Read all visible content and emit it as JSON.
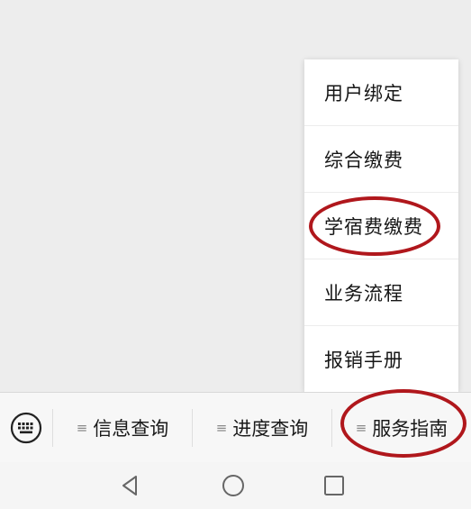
{
  "popup_menu": {
    "items": [
      {
        "label": "用户绑定"
      },
      {
        "label": "综合缴费"
      },
      {
        "label": "学宿费缴费"
      },
      {
        "label": "业务流程"
      },
      {
        "label": "报销手册"
      }
    ]
  },
  "menu_bar": {
    "keyboard_icon": "keyboard-icon",
    "menu_mark": "≡",
    "tabs": [
      {
        "label": "信息查询"
      },
      {
        "label": "进度查询"
      },
      {
        "label": "服务指南"
      }
    ]
  },
  "nav_bar": {
    "icons": [
      "back-triangle-icon",
      "home-circle-icon",
      "recents-square-icon"
    ]
  },
  "colors": {
    "annotation": "#b0171c",
    "background": "#ededed",
    "menu_bg": "#ffffff"
  }
}
